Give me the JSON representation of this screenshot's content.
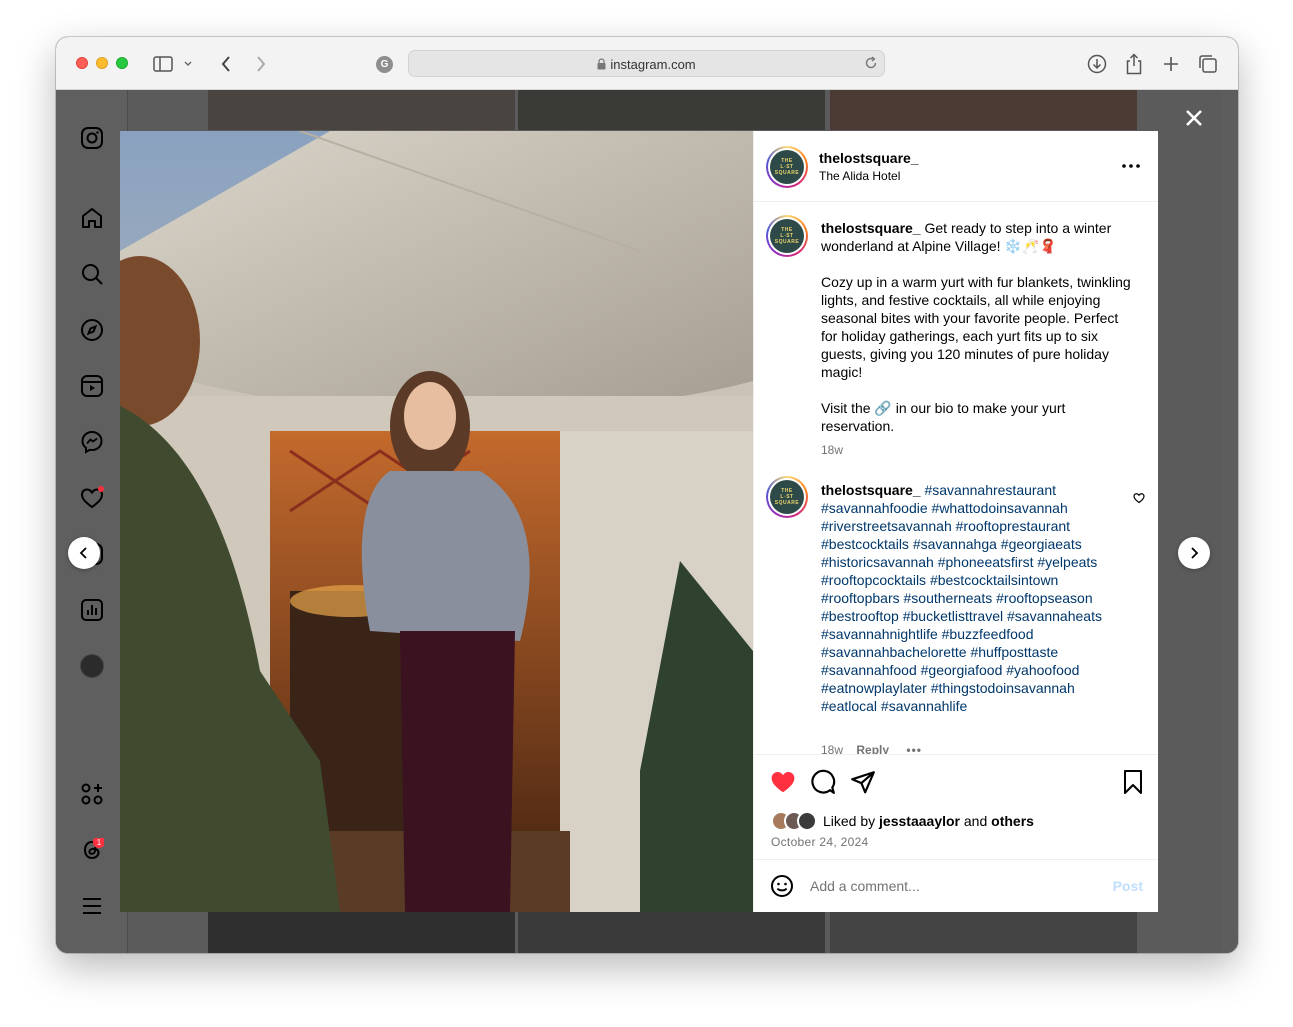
{
  "browser": {
    "url_host": "instagram.com"
  },
  "post": {
    "username": "thelostsquare_",
    "location": "The Alida Hotel",
    "logo_text": [
      "THE",
      "L◦ST",
      "SQUARE"
    ],
    "caption_lines": [
      "Get ready to step into a winter wonderland at Alpine Village! ❄️🥂🧣",
      "",
      "Cozy up in a warm yurt with fur blankets, twinkling lights, and festive cocktails, all while enjoying seasonal bites with your favorite people. Perfect for holiday gatherings, each yurt fits up to six guests, giving you 120 minutes of pure holiday magic!",
      "",
      "Visit the 🔗 in our bio to make your yurt reservation."
    ],
    "caption_time": "18w",
    "comment": {
      "username": "thelostsquare_",
      "hashtags": "#savannahrestaurant #savannahfoodie #whattodoinsavannah #riverstreetsavannah #rooftoprestaurant #bestcocktails #savannahga #georgiaeats #historicsavannah #phoneeatsfirst #yelpeats #rooftopcocktails #bestcocktailsintown #rooftopbars #southerneats #rooftopseason #bestrooftop #bucketlisttravel #savannaheats #savannahnightlife #buzzfeedfood #savannahbachelorette #huffposttaste #savannahfood #georgiafood #yahoofood #eatnowplaylater #thingstodoinsavannah #eatlocal #savannahlife",
      "time": "18w",
      "reply_label": "Reply"
    },
    "likes": {
      "prefix": "Liked by",
      "user": "jesstaaaylor",
      "middle": "and",
      "suffix": "others"
    },
    "date": "October 24, 2024",
    "add_comment_placeholder": "Add a comment...",
    "post_button": "Post"
  },
  "colors": {
    "liked_heart": "#ff3040",
    "link_blue": "#00376b",
    "post_disabled": "#c0dffd"
  },
  "icons": [
    "instagram-icon",
    "home-icon",
    "search-icon",
    "explore-icon",
    "reels-icon",
    "messenger-icon",
    "heart-icon",
    "create-icon",
    "dashboard-icon",
    "profile-avatar",
    "also-from-meta-icon",
    "threads-icon",
    "more-icon"
  ]
}
